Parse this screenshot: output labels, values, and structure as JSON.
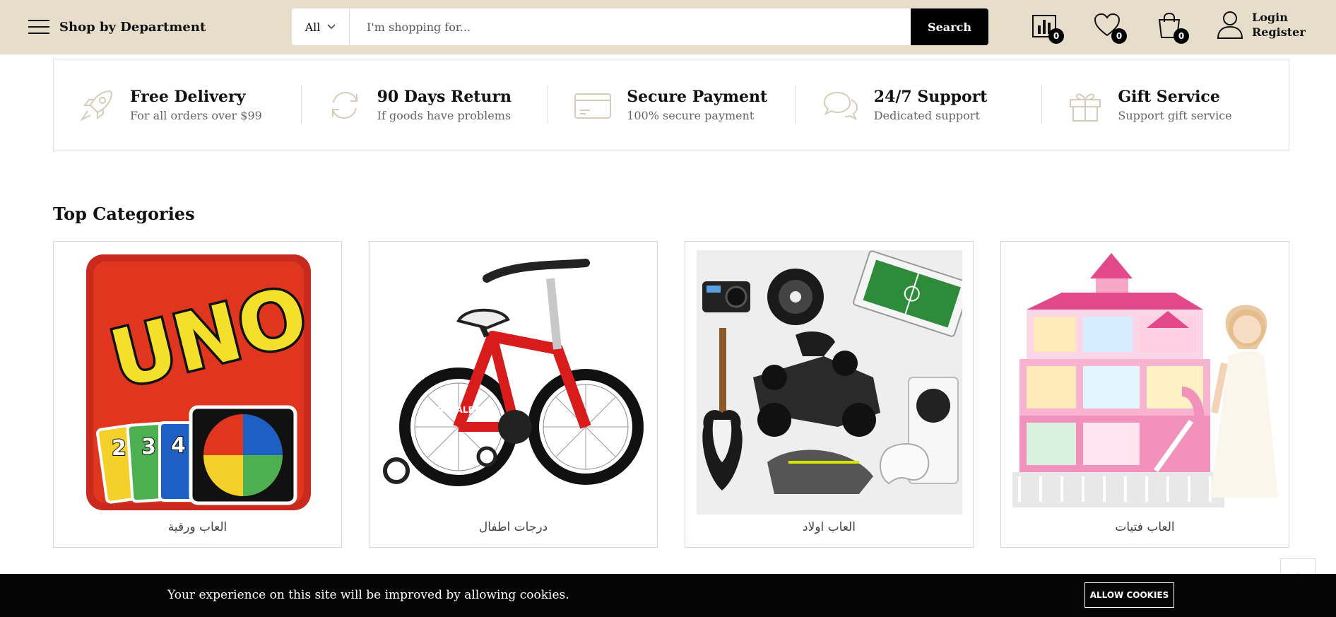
{
  "header": {
    "department_label": "Shop by Department",
    "search": {
      "category": "All",
      "placeholder": "I'm shopping for...",
      "button_label": "Search"
    },
    "compare_count": "0",
    "wishlist_count": "0",
    "cart_count": "0",
    "login_label": "Login",
    "register_label": "Register",
    "background_color": "#e6ddcb"
  },
  "features": [
    {
      "icon": "rocket-icon",
      "title": "Free Delivery",
      "subtitle": "For all orders over $99"
    },
    {
      "icon": "refresh-icon",
      "title": "90 Days Return",
      "subtitle": "If goods have problems"
    },
    {
      "icon": "credit-card-icon",
      "title": "Secure Payment",
      "subtitle": "100% secure payment"
    },
    {
      "icon": "chat-icon",
      "title": "24/7 Support",
      "subtitle": "Dedicated support"
    },
    {
      "icon": "gift-icon",
      "title": "Gift Service",
      "subtitle": "Support gift service"
    }
  ],
  "top_categories": {
    "title": "Top Categories",
    "items": [
      {
        "name": "العاب ورقية",
        "image": "uno-card-game-image"
      },
      {
        "name": "درجات اطفال",
        "image": "kids-bicycle-image"
      },
      {
        "name": "العاب اولاد",
        "image": "boys-toys-collage-image"
      },
      {
        "name": "العاب فتيات",
        "image": "dollhouse-image"
      }
    ]
  },
  "cookie_bar": {
    "message": "Your experience on this site will be improved by allowing cookies.",
    "button_label": "ALLOW COOKIES"
  },
  "icon_color": "#d6ccb8"
}
